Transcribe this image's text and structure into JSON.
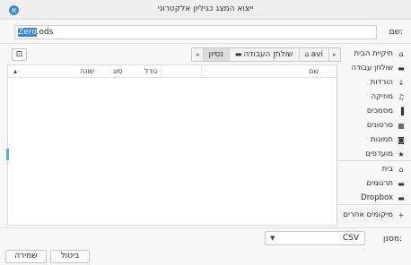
{
  "window": {
    "title": "ייצוא המצג כגיליון אלקטרוני"
  },
  "name_field": {
    "label": "שם:",
    "value_selected": "Zero",
    "value_rest": ".ods"
  },
  "pathbar": {
    "left_arrow": "◂",
    "right_arrow": "▸",
    "crumbs": [
      {
        "label": "נסיון",
        "active": true
      },
      {
        "label": "שולחן העבודה",
        "icon": "desktop-icon"
      },
      {
        "label": "avi",
        "icon": "home-icon"
      }
    ]
  },
  "file_list": {
    "columns": [
      "שם",
      "גודל",
      "סוג",
      "שונה"
    ],
    "sort_indicator": "▴"
  },
  "sidebar": {
    "items": [
      {
        "label": "תיקיית הבית",
        "icon": "home-icon",
        "glyph": "⌂"
      },
      {
        "label": "שולחן עבודה",
        "icon": "desktop-icon",
        "glyph": "▬"
      },
      {
        "label": "הורדות",
        "icon": "download-icon",
        "glyph": "↓"
      },
      {
        "label": "מוזיקה",
        "icon": "music-icon",
        "glyph": "♫"
      },
      {
        "label": "מסמכים",
        "icon": "document-icon",
        "glyph": "▐"
      },
      {
        "label": "סרטונים",
        "icon": "video-icon",
        "glyph": "▦"
      },
      {
        "label": "תמונות",
        "icon": "camera-icon",
        "glyph": "◙"
      },
      {
        "label": "מועדפים",
        "icon": "star-icon",
        "glyph": "★"
      },
      {
        "label": "בית",
        "icon": "home-icon",
        "glyph": "⌂"
      },
      {
        "label": "תרגומים",
        "icon": "folder-icon",
        "glyph": "▬"
      },
      {
        "label": "Dropbox",
        "icon": "folder-icon",
        "glyph": "▬"
      },
      {
        "label": "מיקומים אחרים",
        "icon": "plus-icon",
        "glyph": "+"
      }
    ]
  },
  "filter": {
    "label": "מסנן:",
    "value": "CSV"
  },
  "buttons": {
    "cancel": "ביטול",
    "save": "שמירה"
  }
}
